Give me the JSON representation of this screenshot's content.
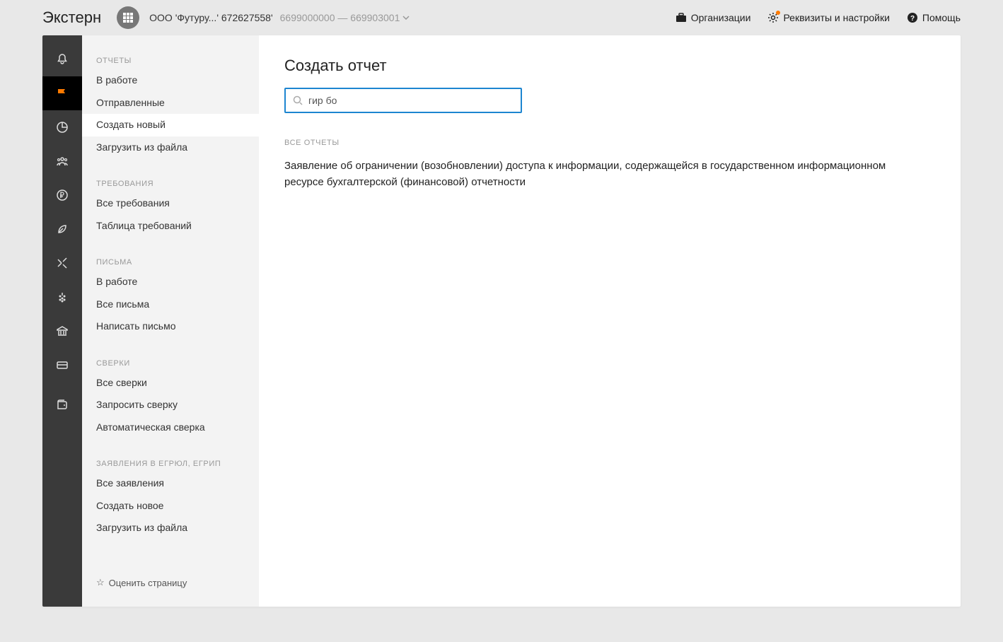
{
  "header": {
    "brand": "Экстерн",
    "org_name": "ООО 'Футуру...' 672627558'",
    "org_codes": "6699000000 — 669903001",
    "links": {
      "organizations": "Организации",
      "settings": "Реквизиты и настройки",
      "help": "Помощь"
    }
  },
  "sidebar": {
    "groups": [
      {
        "title": "ОТЧЕТЫ",
        "items": [
          "В работе",
          "Отправленные",
          "Создать новый",
          "Загрузить из файла"
        ],
        "active_index": 2
      },
      {
        "title": "ТРЕБОВАНИЯ",
        "items": [
          "Все требования",
          "Таблица требований"
        ]
      },
      {
        "title": "ПИСЬМА",
        "items": [
          "В работе",
          "Все письма",
          "Написать письмо"
        ]
      },
      {
        "title": "СВЕРКИ",
        "items": [
          "Все сверки",
          "Запросить сверку",
          "Автоматическая сверка"
        ]
      },
      {
        "title": "ЗАЯВЛЕНИЯ В ЕГРЮЛ, ЕГРИП",
        "items": [
          "Все заявления",
          "Создать новое",
          "Загрузить из файла"
        ]
      }
    ],
    "rate": "Оценить страницу"
  },
  "content": {
    "title": "Создать отчет",
    "search_value": "гир бо",
    "section_label": "ВСЕ ОТЧЕТЫ",
    "result": "Заявление об ограничении (возобновлении) доступа к информации, содержащейся в государственном информационном ресурсе бухгалтерской (финансовой) отчетности"
  }
}
